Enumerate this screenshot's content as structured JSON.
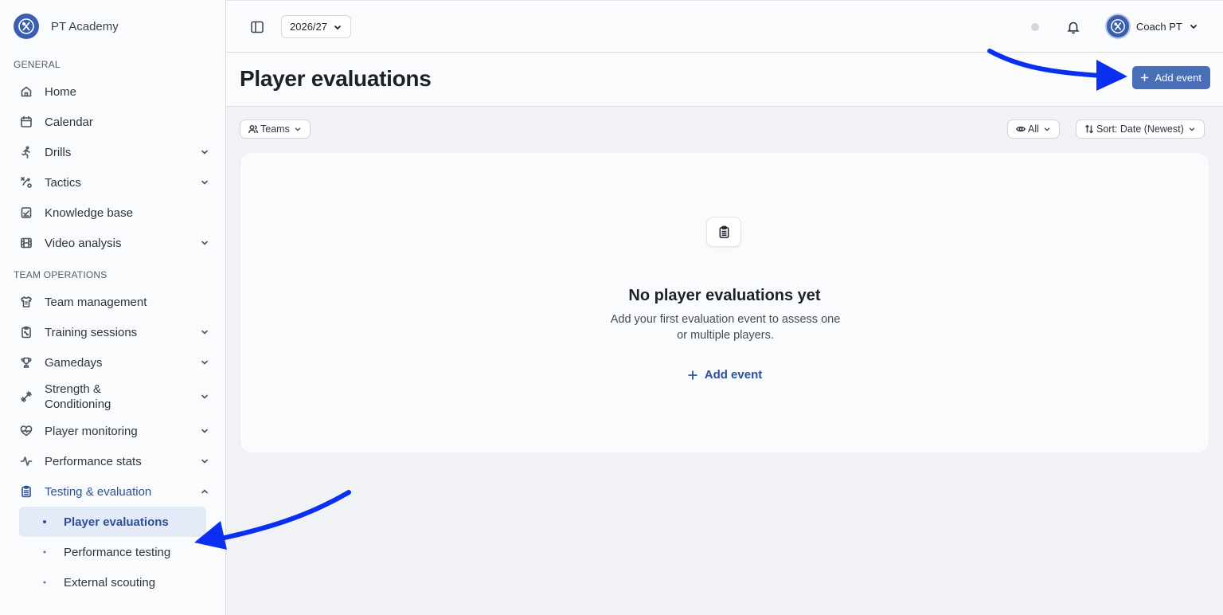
{
  "brand": {
    "name": "PT Academy"
  },
  "sidebar": {
    "sections": [
      {
        "label": "GENERAL",
        "items": [
          {
            "label": "Home",
            "icon": "home-icon",
            "expandable": false
          },
          {
            "label": "Calendar",
            "icon": "calendar-icon",
            "expandable": false
          },
          {
            "label": "Drills",
            "icon": "running-icon",
            "expandable": true
          },
          {
            "label": "Tactics",
            "icon": "tactics-icon",
            "expandable": true
          },
          {
            "label": "Knowledge base",
            "icon": "checklist-icon",
            "expandable": false
          },
          {
            "label": "Video analysis",
            "icon": "film-icon",
            "expandable": true
          }
        ]
      },
      {
        "label": "TEAM OPERATIONS",
        "items": [
          {
            "label": "Team management",
            "icon": "jersey-icon",
            "expandable": false
          },
          {
            "label": "Training sessions",
            "icon": "clipboard-board-icon",
            "expandable": true
          },
          {
            "label": "Gamedays",
            "icon": "trophy-icon",
            "expandable": true
          },
          {
            "label": "Strength &\nConditioning",
            "icon": "dumbbell-icon",
            "expandable": true
          },
          {
            "label": "Player monitoring",
            "icon": "heart-pulse-icon",
            "expandable": true
          },
          {
            "label": "Performance stats",
            "icon": "activity-icon",
            "expandable": true
          },
          {
            "label": "Testing & evaluation",
            "icon": "clipboard-list-icon",
            "expandable": true,
            "open": true,
            "children": [
              {
                "label": "Player evaluations",
                "active": true
              },
              {
                "label": "Performance testing",
                "active": false
              },
              {
                "label": "External scouting",
                "active": false
              }
            ]
          }
        ]
      }
    ]
  },
  "topbar": {
    "season": "2026/27",
    "user_name": "Coach PT",
    "status_color": "#d4d6da"
  },
  "header": {
    "title": "Player evaluations",
    "add_button": "Add event"
  },
  "filters": {
    "teams": "Teams",
    "visibility": "All",
    "sort": "Sort: Date (Newest)"
  },
  "empty_state": {
    "title": "No player evaluations yet",
    "description": "Add your first evaluation event to assess one or multiple players.",
    "action": "Add event"
  },
  "colors": {
    "accent": "#4a6db8",
    "accent_text": "#2c4f9a",
    "active_bg": "#e3ebf8",
    "annotation_arrow": "#0a2ff0"
  }
}
